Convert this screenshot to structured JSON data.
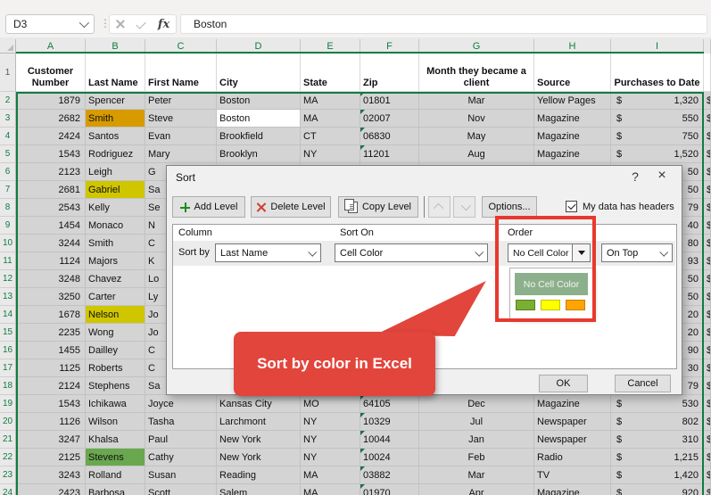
{
  "formula_bar": {
    "name_box": "D3",
    "fx_label": "fx",
    "value": "Boston"
  },
  "grid": {
    "column_letters": [
      "A",
      "B",
      "C",
      "D",
      "E",
      "F",
      "G",
      "H",
      "I"
    ],
    "header_row": {
      "n": "1",
      "a": "Customer Number",
      "b": "Last Name",
      "c": "First Name",
      "d": "City",
      "e": "State",
      "f": "Zip",
      "g": "Month they became a client",
      "h": "Source",
      "i": "Purchases to Date"
    },
    "currency_prefix": "$",
    "rows": [
      {
        "n": "2",
        "a": "1879",
        "b": "Spencer",
        "c": "Peter",
        "d": "Boston",
        "e": "MA",
        "f": "01801",
        "g": "Mar",
        "h": "Yellow Pages",
        "i": "1,320",
        "fill": ""
      },
      {
        "n": "3",
        "a": "2682",
        "b": "Smith",
        "c": "Steve",
        "d": "Boston",
        "e": "MA",
        "f": "02007",
        "g": "Nov",
        "h": "Magazine",
        "i": "550",
        "fill": "gold",
        "active": "d"
      },
      {
        "n": "4",
        "a": "2424",
        "b": "Santos",
        "c": "Evan",
        "d": "Brookfield",
        "e": "CT",
        "f": "06830",
        "g": "May",
        "h": "Magazine",
        "i": "750",
        "fill": ""
      },
      {
        "n": "5",
        "a": "1543",
        "b": "Rodriguez",
        "c": "Mary",
        "d": "Brooklyn",
        "e": "NY",
        "f": "11201",
        "g": "Aug",
        "h": "Magazine",
        "i": "1,520",
        "fill": ""
      },
      {
        "n": "6",
        "a": "2123",
        "b": "Leigh",
        "c": "G",
        "d": "",
        "e": "",
        "f": "",
        "g": "",
        "h": "",
        "i": "50",
        "fill": ""
      },
      {
        "n": "7",
        "a": "2681",
        "b": "Gabriel",
        "c": "Sa",
        "d": "",
        "e": "",
        "f": "",
        "g": "",
        "h": "",
        "i": "50",
        "fill": "yellow"
      },
      {
        "n": "8",
        "a": "2543",
        "b": "Kelly",
        "c": "Se",
        "d": "",
        "e": "",
        "f": "",
        "g": "",
        "h": "",
        "i": "79",
        "fill": ""
      },
      {
        "n": "9",
        "a": "1454",
        "b": "Monaco",
        "c": "N",
        "d": "",
        "e": "",
        "f": "",
        "g": "",
        "h": "",
        "i": "40",
        "fill": ""
      },
      {
        "n": "10",
        "a": "3244",
        "b": "Smith",
        "c": "C",
        "d": "",
        "e": "",
        "f": "",
        "g": "",
        "h": "",
        "i": "80",
        "fill": ""
      },
      {
        "n": "11",
        "a": "1124",
        "b": "Majors",
        "c": "K",
        "d": "",
        "e": "",
        "f": "",
        "g": "",
        "h": "",
        "i": "93",
        "fill": ""
      },
      {
        "n": "12",
        "a": "3248",
        "b": "Chavez",
        "c": "Lo",
        "d": "",
        "e": "",
        "f": "",
        "g": "",
        "h": "",
        "i": "50",
        "fill": ""
      },
      {
        "n": "13",
        "a": "3250",
        "b": "Carter",
        "c": "Ly",
        "d": "",
        "e": "",
        "f": "",
        "g": "",
        "h": "",
        "i": "50",
        "fill": ""
      },
      {
        "n": "14",
        "a": "1678",
        "b": "Nelson",
        "c": "Jo",
        "d": "",
        "e": "",
        "f": "",
        "g": "",
        "h": "",
        "i": "20",
        "fill": "yellow"
      },
      {
        "n": "15",
        "a": "2235",
        "b": "Wong",
        "c": "Jo",
        "d": "",
        "e": "",
        "f": "",
        "g": "",
        "h": "",
        "i": "20",
        "fill": ""
      },
      {
        "n": "16",
        "a": "1455",
        "b": "Dailley",
        "c": "C",
        "d": "",
        "e": "",
        "f": "",
        "g": "",
        "h": "",
        "i": "90",
        "fill": ""
      },
      {
        "n": "17",
        "a": "1125",
        "b": "Roberts",
        "c": "C",
        "d": "",
        "e": "",
        "f": "",
        "g": "",
        "h": "",
        "i": "30",
        "fill": ""
      },
      {
        "n": "18",
        "a": "2124",
        "b": "Stephens",
        "c": "Sa",
        "d": "",
        "e": "",
        "f": "",
        "g": "",
        "h": "",
        "i": "79",
        "fill": ""
      },
      {
        "n": "19",
        "a": "1543",
        "b": "Ichikawa",
        "c": "Joyce",
        "d": "Kansas City",
        "e": "MO",
        "f": "64105",
        "g": "Dec",
        "h": "Magazine",
        "i": "530",
        "fill": ""
      },
      {
        "n": "20",
        "a": "1126",
        "b": "Wilson",
        "c": "Tasha",
        "d": "Larchmont",
        "e": "NY",
        "f": "10329",
        "g": "Jul",
        "h": "Newspaper",
        "i": "802",
        "fill": ""
      },
      {
        "n": "21",
        "a": "3247",
        "b": "Khalsa",
        "c": "Paul",
        "d": "New York",
        "e": "NY",
        "f": "10044",
        "g": "Jan",
        "h": "Newspaper",
        "i": "310",
        "fill": ""
      },
      {
        "n": "22",
        "a": "2125",
        "b": "Stevens",
        "c": "Cathy",
        "d": "New York",
        "e": "NY",
        "f": "10024",
        "g": "Feb",
        "h": "Radio",
        "i": "1,215",
        "fill": "green"
      },
      {
        "n": "23",
        "a": "3243",
        "b": "Rolland",
        "c": "Susan",
        "d": "Reading",
        "e": "MA",
        "f": "03882",
        "g": "Mar",
        "h": "TV",
        "i": "1,420",
        "fill": ""
      },
      {
        "n": "24",
        "a": "2423",
        "b": "Barbosa",
        "c": "Scott",
        "d": "Salem",
        "e": "MA",
        "f": "01970",
        "g": "Apr",
        "h": "Magazine",
        "i": "920",
        "fill": ""
      }
    ]
  },
  "dialog": {
    "title": "Sort",
    "help_icon": "?",
    "close_icon": "×",
    "toolbar": {
      "add_level": "Add Level",
      "delete_level": "Delete Level",
      "copy_level": "Copy Level",
      "options": "Options...",
      "my_data_has_headers": "My data has headers"
    },
    "list": {
      "column_label": "Column",
      "sort_on_label": "Sort On",
      "order_label": "Order",
      "sort_by_label": "Sort by",
      "column_value": "Last Name",
      "sort_on_value": "Cell Color",
      "order_value": "No Cell Color",
      "position_value": "On Top"
    },
    "popup": {
      "selected_item": "No Cell Color",
      "swatches": [
        {
          "name": "green",
          "fill": "#77b032",
          "border": "#5f7d1c"
        },
        {
          "name": "yellow",
          "fill": "#ffff00",
          "border": "#c3c300"
        },
        {
          "name": "orange",
          "fill": "#ffa400",
          "border": "#c87f00"
        }
      ]
    },
    "ok": "OK",
    "cancel": "Cancel"
  },
  "callout": {
    "text": "Sort by color in Excel"
  },
  "colors": {
    "excel_green": "#107c41",
    "selection_gray": "#d4d4d4",
    "fill_gold": "#d79b00",
    "fill_yellow": "#d0c600",
    "fill_green": "#6aa84f",
    "popup_selected_bg": "#8cb08c",
    "highlight_red": "#e8382e",
    "callout_red": "#e2453c"
  }
}
